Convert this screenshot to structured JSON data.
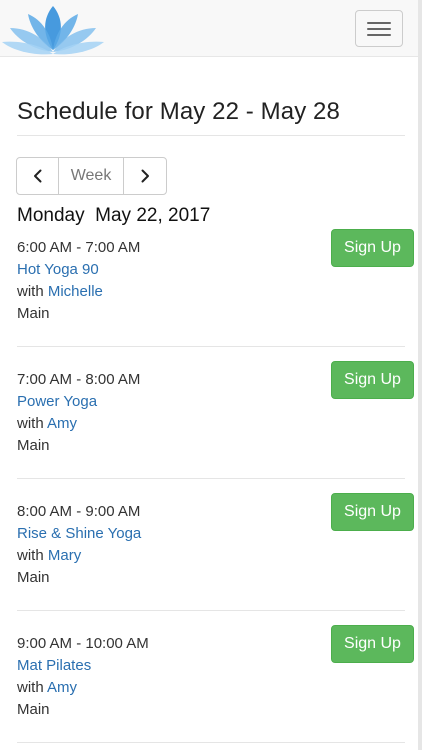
{
  "header": {
    "logo_icon": "lotus-logo-icon",
    "menu_icon": "hamburger-menu-icon"
  },
  "page": {
    "title": "Schedule for May 22 - May 28"
  },
  "nav": {
    "prev_icon": "chevron-left-icon",
    "view_label": "Week",
    "next_icon": "chevron-right-icon"
  },
  "day": {
    "heading": "Monday  May 22, 2017"
  },
  "classes": [
    {
      "time": "6:00 AM - 7:00 AM",
      "name": "Hot Yoga 90",
      "with": "with",
      "instructor": "Michelle",
      "room": "Main",
      "button": "Sign Up"
    },
    {
      "time": "7:00 AM - 8:00 AM",
      "name": "Power Yoga",
      "with": "with",
      "instructor": "Amy",
      "room": "Main",
      "button": "Sign Up"
    },
    {
      "time": "8:00 AM - 9:00 AM",
      "name": "Rise & Shine Yoga",
      "with": "with",
      "instructor": "Mary",
      "room": "Main",
      "button": "Sign Up"
    },
    {
      "time": "9:00 AM - 10:00 AM",
      "name": "Mat Pilates",
      "with": "with",
      "instructor": "Amy",
      "room": "Main",
      "button": "Sign Up"
    }
  ],
  "colors": {
    "link": "#2a6fb0",
    "signup": "#5cb85c",
    "logo": "#4a9fe0"
  }
}
